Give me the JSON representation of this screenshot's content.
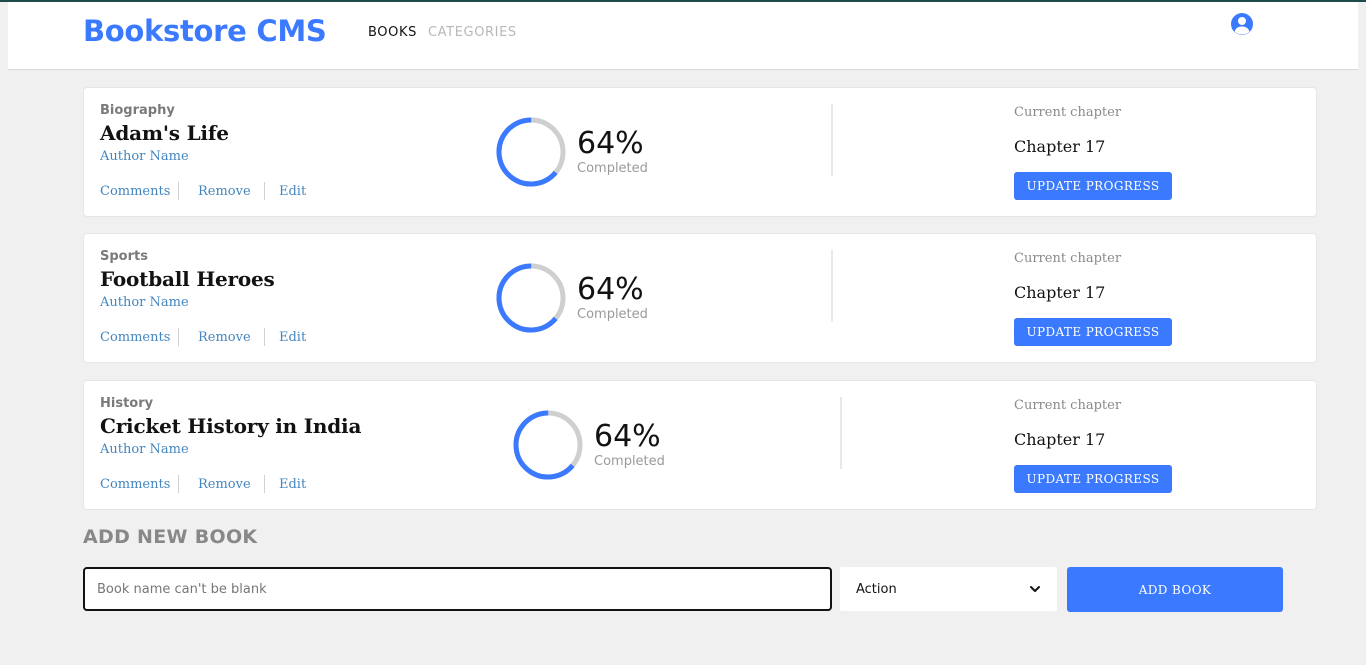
{
  "header": {
    "brand": "Bookstore CMS",
    "nav": {
      "books": "BOOKS",
      "categories": "CATEGORIES"
    },
    "user_icon": "user-circle-icon",
    "accent_color": "#3b7aff"
  },
  "books": [
    {
      "category": "Biography",
      "title": "Adam's Life",
      "author": "Author Name",
      "actions": {
        "comments": "Comments",
        "remove": "Remove",
        "edit": "Edit"
      },
      "progress_percent": 64,
      "progress_text": "64%",
      "progress_label": "Completed",
      "chapter_label": "Current chapter",
      "chapter": "Chapter 17",
      "update_button": "UPDATE PROGRESS"
    },
    {
      "category": "Sports",
      "title": "Football Heroes",
      "author": "Author Name",
      "actions": {
        "comments": "Comments",
        "remove": "Remove",
        "edit": "Edit"
      },
      "progress_percent": 64,
      "progress_text": "64%",
      "progress_label": "Completed",
      "chapter_label": "Current chapter",
      "chapter": "Chapter 17",
      "update_button": "UPDATE PROGRESS"
    },
    {
      "category": "History",
      "title": "Cricket History in India",
      "author": "Author Name",
      "actions": {
        "comments": "Comments",
        "remove": "Remove",
        "edit": "Edit"
      },
      "progress_percent": 64,
      "progress_text": "64%",
      "progress_label": "Completed",
      "chapter_label": "Current chapter",
      "chapter": "Chapter 17",
      "update_button": "UPDATE PROGRESS"
    }
  ],
  "add_form": {
    "heading": "ADD NEW BOOK",
    "input_value": "",
    "input_placeholder": "Book name can't be blank",
    "category_selected": "Action",
    "submit_label": "ADD BOOK"
  }
}
